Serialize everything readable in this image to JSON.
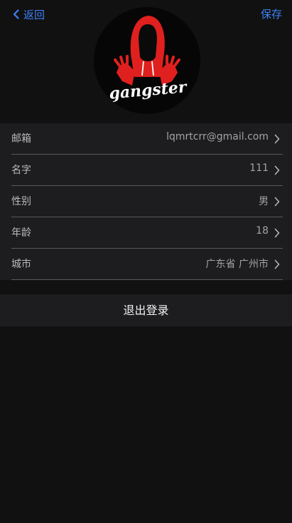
{
  "navbar": {
    "back_label": "返回",
    "save_label": "保存"
  },
  "avatar": {
    "image": "gangster-hoodie-logo",
    "logo_text": "gangster"
  },
  "profile": {
    "rows": [
      {
        "label": "邮箱",
        "value": "lqmrtcrr@gmail.com"
      },
      {
        "label": "名字",
        "value": "111"
      },
      {
        "label": "性别",
        "value": "男"
      },
      {
        "label": "年龄",
        "value": "18"
      },
      {
        "label": "城市",
        "value": "广东省 广州市"
      }
    ]
  },
  "logout_label": "退出登录",
  "colors": {
    "accent": "#3d82f6",
    "background": "#111111",
    "panel": "#1d1d1f",
    "logo_red": "#e0201e"
  }
}
